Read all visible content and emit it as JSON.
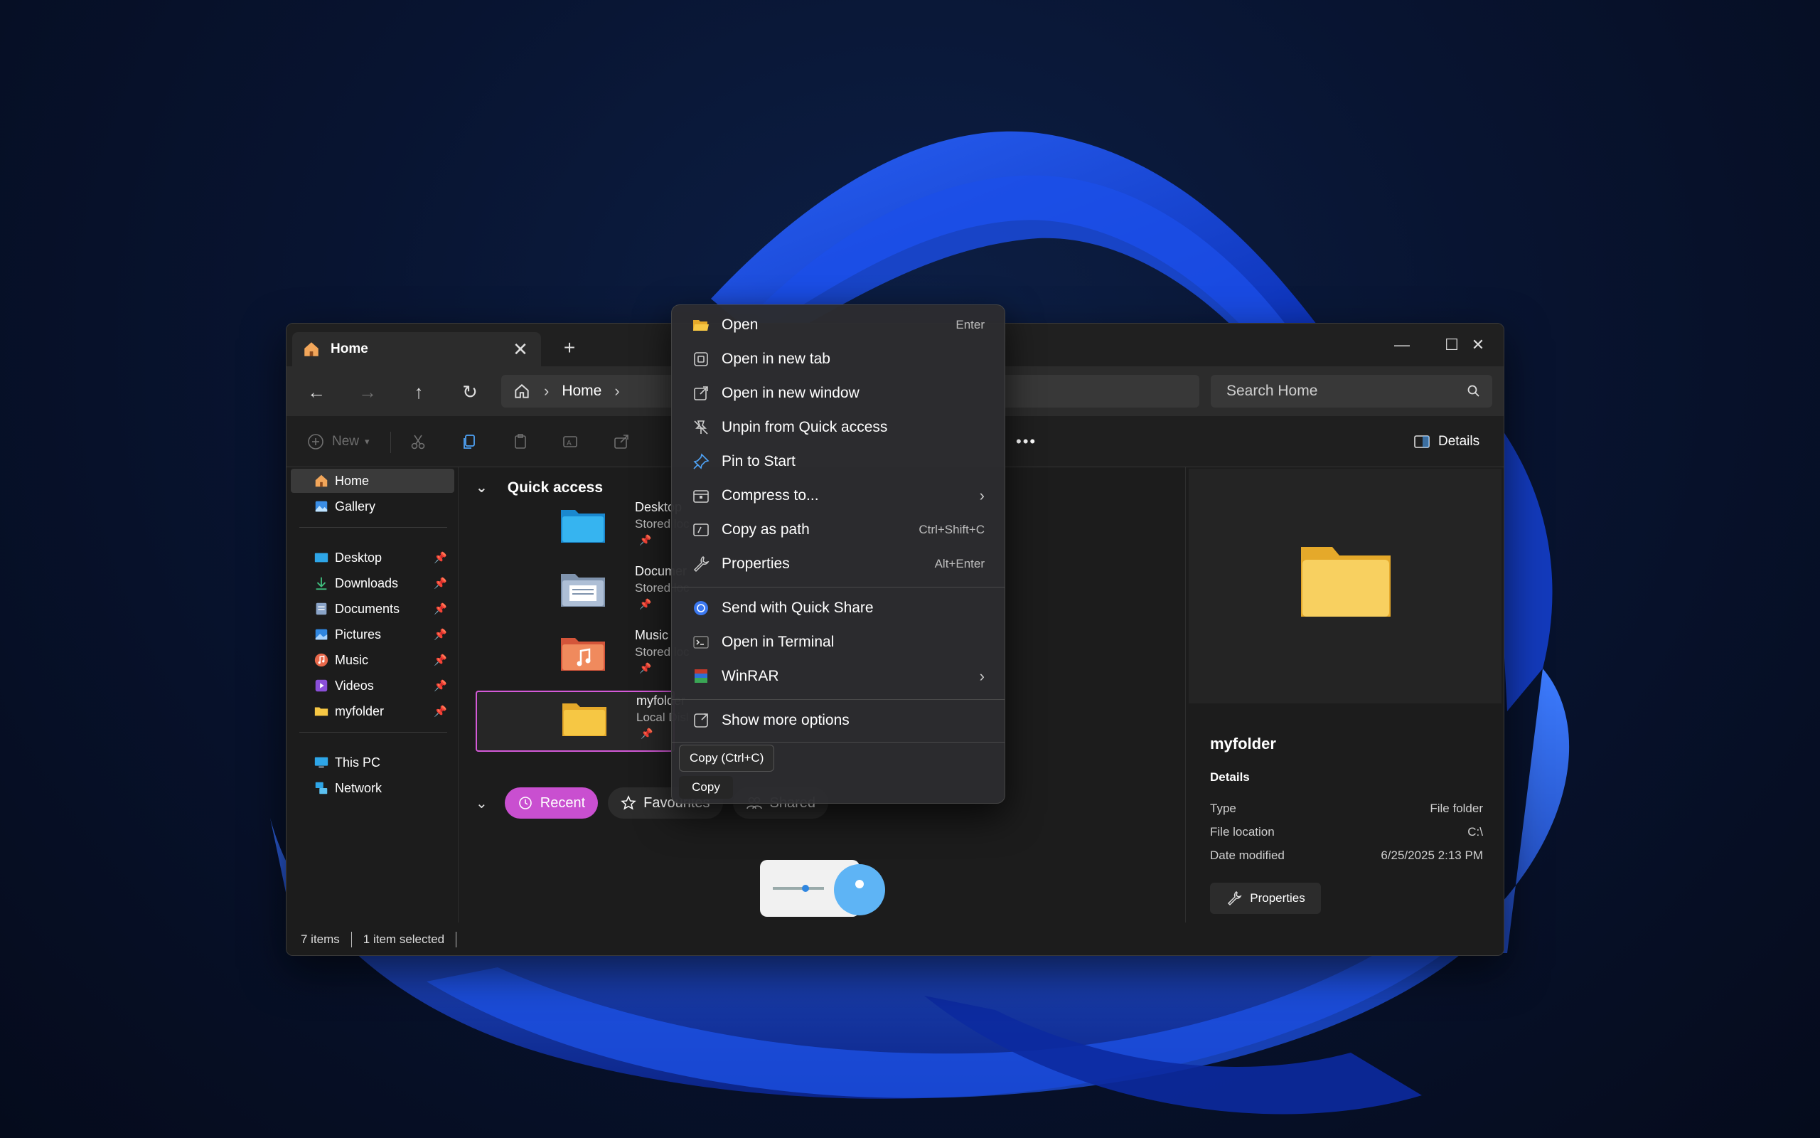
{
  "window": {
    "tab_title": "Home",
    "tab_close": "✕",
    "new_tab": "+",
    "minimize": "—",
    "maximize": "☐",
    "close": "✕"
  },
  "nav": {
    "back": "←",
    "forward": "→",
    "up": "↑",
    "refresh": "↻",
    "breadcrumb": [
      "Home"
    ],
    "search_placeholder": "Search Home"
  },
  "toolbar": {
    "new_label": "New",
    "more": "•••",
    "details_label": "Details"
  },
  "sidebar": {
    "top": [
      {
        "label": "Home",
        "icon": "home-icon"
      },
      {
        "label": "Gallery",
        "icon": "gallery-icon"
      }
    ],
    "pinned": [
      {
        "label": "Desktop",
        "icon": "desktop-icon"
      },
      {
        "label": "Downloads",
        "icon": "download-icon"
      },
      {
        "label": "Documents",
        "icon": "documents-icon"
      },
      {
        "label": "Pictures",
        "icon": "pictures-icon"
      },
      {
        "label": "Music",
        "icon": "music-icon"
      },
      {
        "label": "Videos",
        "icon": "videos-icon"
      },
      {
        "label": "myfolder",
        "icon": "folder-icon"
      }
    ],
    "bottom": [
      {
        "label": "This PC",
        "icon": "pc-icon"
      },
      {
        "label": "Network",
        "icon": "network-icon"
      }
    ]
  },
  "content": {
    "quick_access_title": "Quick access",
    "items": [
      {
        "name": "Desktop",
        "sub": "Stored loc"
      },
      {
        "name": "Documer",
        "sub": "Stored loc"
      },
      {
        "name": "Music",
        "sub": "Stored loc"
      },
      {
        "name": "myfolder",
        "sub": "Local Disl"
      }
    ],
    "filters": [
      "Recent",
      "Favourites",
      "Shared"
    ]
  },
  "details": {
    "name": "myfolder",
    "section": "Details",
    "rows": [
      {
        "key": "Type",
        "value": "File folder"
      },
      {
        "key": "File location",
        "value": "C:\\"
      },
      {
        "key": "Date modified",
        "value": "6/25/2025 2:13 PM"
      }
    ],
    "properties_label": "Properties"
  },
  "status": {
    "count": "7 items",
    "selected": "1 item selected"
  },
  "context_menu": {
    "items": [
      {
        "label": "Open",
        "shortcut": "Enter"
      },
      {
        "label": "Open in new tab",
        "shortcut": ""
      },
      {
        "label": "Open in new window",
        "shortcut": ""
      },
      {
        "label": "Unpin from Quick access",
        "shortcut": ""
      },
      {
        "label": "Pin to Start",
        "shortcut": ""
      },
      {
        "label": "Compress to...",
        "shortcut": ""
      },
      {
        "label": "Copy as path",
        "shortcut": "Ctrl+Shift+C"
      },
      {
        "label": "Properties",
        "shortcut": "Alt+Enter"
      },
      {
        "label": "Send with Quick Share",
        "shortcut": ""
      },
      {
        "label": "Open in Terminal",
        "shortcut": ""
      },
      {
        "label": "WinRAR",
        "shortcut": ""
      },
      {
        "label": "Show more options",
        "shortcut": ""
      }
    ],
    "tooltip": "Copy (Ctrl+C)",
    "copy_label": "Copy"
  },
  "colors": {
    "accent": "#c94fd0",
    "folder": "#f6c744"
  }
}
